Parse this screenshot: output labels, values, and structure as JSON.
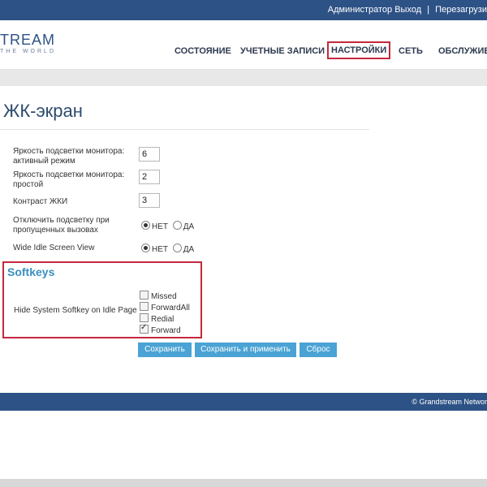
{
  "topbar": {
    "user": "Администратор",
    "logout": "Выход",
    "separator": "|",
    "reboot": "Перезагрузи"
  },
  "logo": {
    "main": "TREAM",
    "sub": "THE WORLD"
  },
  "nav": {
    "items": [
      "СОСТОЯНИЕ",
      "УЧЕТНЫЕ ЗАПИСИ",
      "НАСТРОЙКИ",
      "СЕТЬ",
      "ОБСЛУЖИВА"
    ],
    "active": "НАСТРОЙКИ"
  },
  "page": {
    "title": "ЖК-экран"
  },
  "settings": [
    {
      "label": "Яркость подсветки монитора: активный режим",
      "value": "6"
    },
    {
      "label": "Яркость подсветки монитора: простой",
      "value": "2"
    },
    {
      "label": "Контраст ЖКИ",
      "value": "3"
    }
  ],
  "radios": {
    "no": "НЕТ",
    "yes": "ДА",
    "missed_label": "Отключить подсветку при пропущенных вызовах",
    "missed_value": "НЕТ",
    "wide_label": "Wide Idle Screen View",
    "wide_value": "НЕТ"
  },
  "softkeys": {
    "title": "Softkeys",
    "hide_label": "Hide System Softkey on Idle Page",
    "options": [
      {
        "label": "Missed",
        "checked": false
      },
      {
        "label": "ForwardAll",
        "checked": false
      },
      {
        "label": "Redial",
        "checked": false
      },
      {
        "label": "Forward",
        "checked": true
      }
    ]
  },
  "buttons": {
    "save": "Сохранить",
    "save_apply": "Сохранить и применить",
    "reset": "Сброс"
  },
  "footer": {
    "copyright": "© Grandstream Networ"
  },
  "colors": {
    "brand": "#2d5286",
    "button": "#4aa3d4",
    "highlight": "#c5283d"
  }
}
